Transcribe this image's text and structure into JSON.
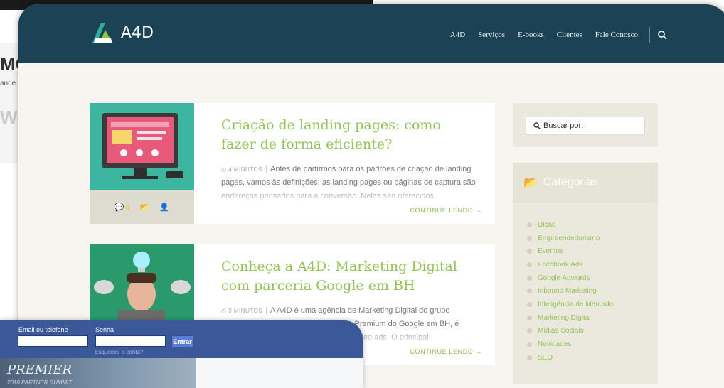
{
  "background": {
    "left_heading": "MO",
    "left_snippet": "ande",
    "left_fade": "WO"
  },
  "site": {
    "logo_text": "A4D",
    "nav": [
      "A4D",
      "Serviços",
      "E-books",
      "Clientes",
      "Fale Conosco"
    ],
    "search_icon": "search-icon"
  },
  "articles": [
    {
      "title": "Criação de landing pages: como fazer de forma eficiente?",
      "read_time": "4 MINUTOS",
      "excerpt": "Antes de partirmos para os padrões de criação de landing pages, vamos às definições: as landing pages ou páginas de captura são endereços pensados para a conversão. Nelas são oferecidos",
      "comments": "0",
      "continue": "CONTINUE LENDO →"
    },
    {
      "title": "Conheça a A4D: Marketing Digital com parceria Google em BH",
      "read_time": "3 MINUTOS",
      "excerpt": "A A4D é uma agência de Marketing Digital do grupo Rihappy, que foi credenciada parceira Premium do Google em BH, é certificada nas áreas de search ads e video ads. O principal",
      "comments": "",
      "continue": "CONTINUE LENDO →"
    }
  ],
  "sidebar": {
    "search_placeholder": "Buscar por:",
    "categories_title": "Categorias",
    "categories": [
      "Dicas",
      "Empreendedorismo",
      "Eventos",
      "Facebook Ads",
      "Google Adwords",
      "Inbound Marketing",
      "Inteligência de Mercado",
      "Marketing Digital",
      "Mídias Sociais",
      "Novidades",
      "SEO"
    ]
  },
  "facebook": {
    "email_label": "Email ou telefone",
    "password_label": "Senha",
    "login_button": "Entrar",
    "forgot": "Esqueceu a conta?",
    "banner_line1": "PREMIER",
    "banner_line2": "2018 PARTNER SUMMIT"
  },
  "colors": {
    "header": "#1c4256",
    "accent_green": "#93c35a",
    "facebook_blue": "#3b5998"
  }
}
